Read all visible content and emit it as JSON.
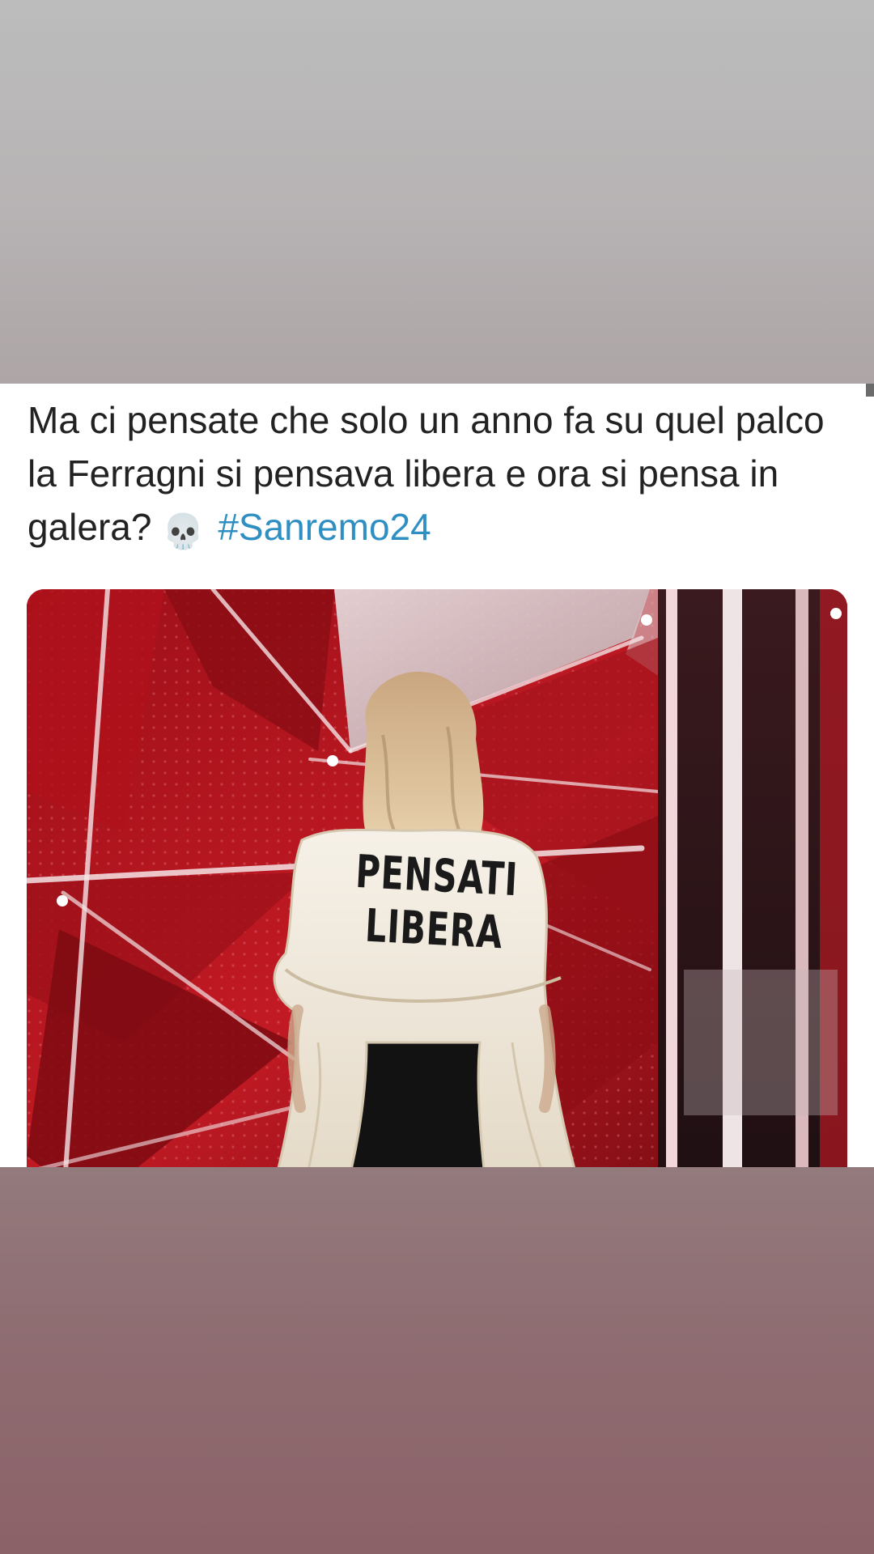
{
  "story": {
    "top_band_color": "#bcbcbc",
    "bottom_band_color": "#8e6b70"
  },
  "tweet": {
    "text": "Ma ci pensate che solo un anno fa su quel palco la Ferragni si pensava libera e ora si pensa in galera?",
    "emoji": "💀",
    "hashtag": "#Sanremo24",
    "hashtag_color": "#2f8fc2",
    "media": {
      "cape_line_1": "PENSATI",
      "cape_line_2": "LIBERA"
    }
  }
}
